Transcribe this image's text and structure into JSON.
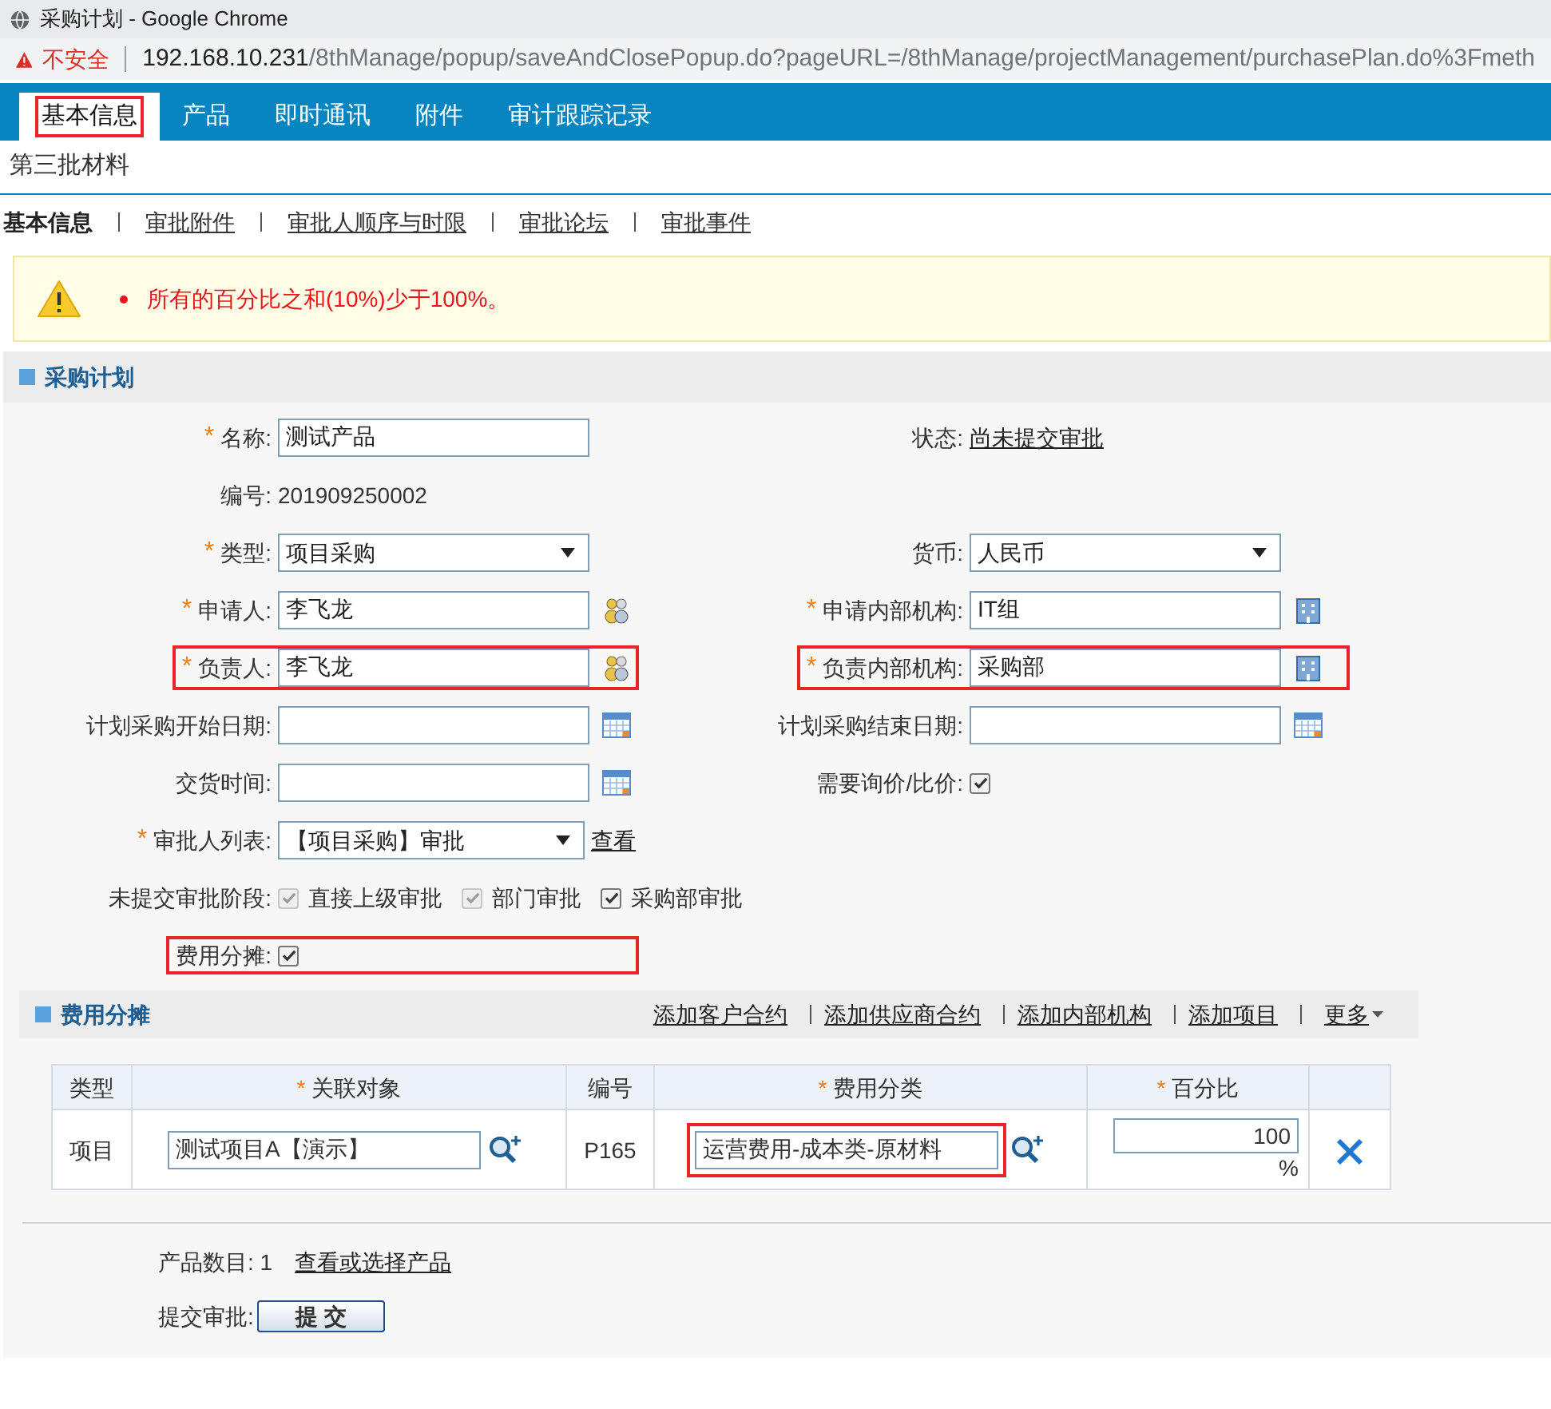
{
  "browser": {
    "title": "采购计划 - Google Chrome",
    "security": "不安全",
    "url_host": "192.168.10.231",
    "url_path": "/8thManage/popup/saveAndClosePopup.do?pageURL=/8thManage/projectManagement/purchasePlan.do%3Fmeth"
  },
  "main_tabs": [
    {
      "label": "基本信息",
      "selected": true,
      "highlighted": true
    },
    {
      "label": "产品",
      "selected": false,
      "highlighted": false
    },
    {
      "label": "即时通讯",
      "selected": false,
      "highlighted": false
    },
    {
      "label": "附件",
      "selected": false,
      "highlighted": false
    },
    {
      "label": "审计跟踪记录",
      "selected": false,
      "highlighted": false
    }
  ],
  "page_title": "第三批材料",
  "sub_tabs": [
    {
      "label": "基本信息",
      "selected": true
    },
    {
      "label": "审批附件",
      "selected": false
    },
    {
      "label": "审批人顺序与时限",
      "selected": false
    },
    {
      "label": "审批论坛",
      "selected": false
    },
    {
      "label": "审批事件",
      "selected": false
    }
  ],
  "alert": {
    "message": "所有的百分比之和(10%)少于100%。"
  },
  "section": {
    "title": "采购计划"
  },
  "form_rows": [
    {
      "left": {
        "kind": "text",
        "label": "名称:",
        "required_mark": "*",
        "value": "测试产品",
        "highlighted": false
      },
      "right": {
        "kind": "link",
        "label": "状态:",
        "value": "尚未提交审批",
        "highlighted": false
      }
    },
    {
      "left": {
        "kind": "static",
        "label": "编号:",
        "value": "201909250002",
        "highlighted": false
      }
    },
    {
      "left": {
        "kind": "select",
        "label": "类型:",
        "required_mark": "*",
        "value": "项目采购",
        "highlighted": false
      },
      "right": {
        "kind": "select",
        "label": "货币:",
        "value": "人民币",
        "highlighted": false
      }
    },
    {
      "left": {
        "kind": "person",
        "label": "申请人:",
        "required_mark": "*",
        "value": "李飞龙",
        "highlighted": false
      },
      "right": {
        "kind": "org",
        "label": "申请内部机构:",
        "required_mark": "*",
        "value": "IT组",
        "highlighted": false
      }
    },
    {
      "left": {
        "kind": "person",
        "label": "负责人:",
        "required_mark": "*",
        "value": "李飞龙",
        "highlighted": true
      },
      "right": {
        "kind": "org",
        "label": "负责内部机构:",
        "required_mark": "*",
        "value": "采购部",
        "highlighted": true
      }
    },
    {
      "left": {
        "kind": "date",
        "label": "计划采购开始日期:",
        "highlighted": false
      },
      "right": {
        "kind": "date",
        "label": "计划采购结束日期:",
        "highlighted": false
      }
    },
    {
      "left": {
        "kind": "date",
        "label": "交货时间:",
        "highlighted": false
      },
      "right": {
        "kind": "checkbox",
        "label": "需要询价/比价:",
        "checked": true,
        "highlighted": false
      }
    },
    {
      "left": {
        "kind": "select",
        "label": "审批人列表:",
        "required_mark": "*",
        "value": "【项目采购】审批",
        "link": "查看",
        "highlighted": false
      }
    },
    {
      "left": {
        "kind": "checkboxes",
        "label": "未提交审批阶段:",
        "highlighted": false,
        "options": [
          {
            "label": "直接上级审批",
            "checked": true,
            "disabled": true
          },
          {
            "label": "部门审批",
            "checked": true,
            "disabled": true
          },
          {
            "label": "采购部审批",
            "checked": true,
            "disabled": false
          }
        ]
      }
    },
    {
      "left": {
        "kind": "checkbox",
        "label": "费用分摊:",
        "checked": true,
        "highlighted": true
      }
    }
  ],
  "cost_section": {
    "title": "费用分摊",
    "actions": [
      "添加客户合约",
      "添加供应商合约",
      "添加内部机构",
      "添加项目"
    ],
    "more": "更多"
  },
  "cost_table": {
    "columns": [
      {
        "label": "类型"
      },
      {
        "label": "关联对象",
        "required_mark": "*"
      },
      {
        "label": "编号"
      },
      {
        "label": "费用分类",
        "required_mark": "*"
      },
      {
        "label": "百分比",
        "required_mark": "*"
      },
      {}
    ],
    "rows": [
      {
        "type": "项目",
        "object": "测试项目A【演示】",
        "code": "P165",
        "category": "运营费用-成本类-原材料",
        "category_highlighted": true,
        "percent": "100",
        "percent_unit": "%"
      }
    ]
  },
  "footer": {
    "count_label": "产品数目:",
    "count": "1",
    "count_link": "查看或选择产品",
    "submit_label": "提交审批:",
    "submit_button": "提 交"
  }
}
